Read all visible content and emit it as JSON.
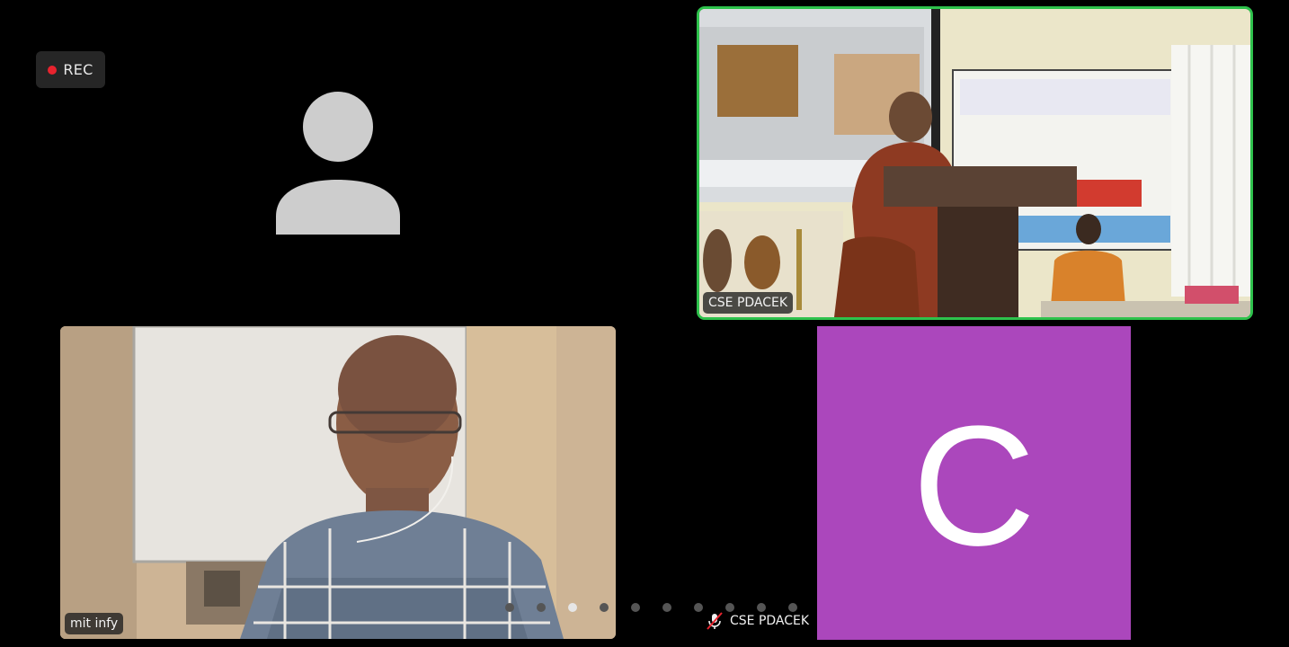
{
  "recording": {
    "label": "REC",
    "dot_color": "#e8232e"
  },
  "participants": {
    "speaker": {
      "name": "CSE PDACEK",
      "highlight_color": "#2ec24c"
    },
    "mit": {
      "name": "mit infy"
    },
    "c_tile": {
      "initial": "C",
      "name": "CSE PDACEK",
      "bg_color": "#ab47bc",
      "muted": true
    }
  },
  "pagination": {
    "total": 10,
    "active_index": 2
  }
}
